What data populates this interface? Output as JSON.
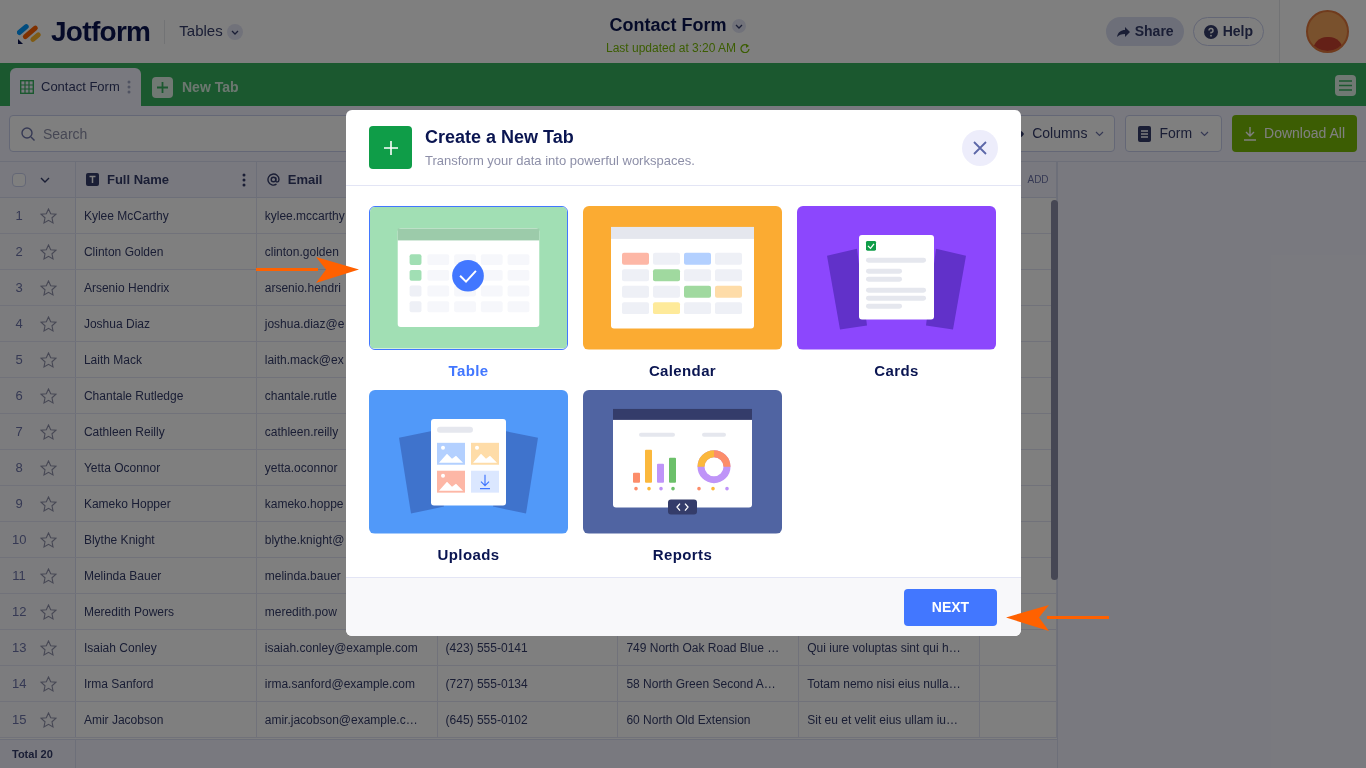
{
  "header": {
    "logo_text": "Jotform",
    "product": "Tables",
    "title": "Contact Form",
    "subtitle": "Last updated at 3:20 AM",
    "buttons": [
      {
        "label": "Share",
        "kind": "share"
      },
      {
        "label": "Help",
        "kind": "help"
      }
    ]
  },
  "tabs": [
    {
      "label": "Contact Form",
      "selected": true
    }
  ],
  "new_tab": {
    "label": "New Tab"
  },
  "toolbar": {
    "search": {
      "placeholder": "Search"
    },
    "buttons": [
      {
        "label": "Columns",
        "kind": "columns"
      },
      {
        "label": "Form",
        "kind": "form"
      },
      {
        "label": "Download All",
        "kind": "download"
      }
    ]
  },
  "table": {
    "select_all": {
      "checked": false
    },
    "columns": [
      {
        "label": "Full Name",
        "kind": "text"
      },
      {
        "label": "Email",
        "kind": "email"
      }
    ],
    "add_column": "ADD",
    "rows": [
      {
        "number": "1",
        "starred": false,
        "cells": [
          "Kylee McCarthy",
          "kylee.mccarthy"
        ]
      },
      {
        "number": "2",
        "starred": false,
        "cells": [
          "Clinton Golden",
          "clinton.golden"
        ]
      },
      {
        "number": "3",
        "starred": false,
        "cells": [
          "Arsenio Hendrix",
          "arsenio.hendri"
        ]
      },
      {
        "number": "4",
        "starred": false,
        "cells": [
          "Joshua Diaz",
          "joshua.diaz@e"
        ]
      },
      {
        "number": "5",
        "starred": false,
        "cells": [
          "Laith Mack",
          "laith.mack@ex"
        ]
      },
      {
        "number": "6",
        "starred": false,
        "cells": [
          "Chantale Rutledge",
          "chantale.rutle"
        ]
      },
      {
        "number": "7",
        "starred": false,
        "cells": [
          "Cathleen Reilly",
          "cathleen.reilly"
        ]
      },
      {
        "number": "8",
        "starred": false,
        "cells": [
          "Yetta Oconnor",
          "yetta.oconnor"
        ]
      },
      {
        "number": "9",
        "starred": false,
        "cells": [
          "Kameko Hopper",
          "kameko.hoppe"
        ]
      },
      {
        "number": "10",
        "starred": false,
        "cells": [
          "Blythe Knight",
          "blythe.knight@"
        ]
      },
      {
        "number": "11",
        "starred": false,
        "cells": [
          "Melinda Bauer",
          "melinda.bauer"
        ]
      },
      {
        "number": "12",
        "starred": false,
        "cells": [
          "Meredith Powers",
          "meredith.pow"
        ]
      },
      {
        "number": "13",
        "starred": false,
        "cells": [
          "Isaiah Conley",
          "isaiah.conley@example.com",
          "(423) 555-0141",
          "749 North Oak Road Blue …",
          "Qui iure voluptas sint qui h…"
        ]
      },
      {
        "number": "14",
        "starred": false,
        "cells": [
          "Irma Sanford",
          "irma.sanford@example.com",
          "(727) 555-0134",
          "58 North Green Second A…",
          "Totam nemo nisi eius nulla…"
        ]
      },
      {
        "number": "15",
        "starred": false,
        "cells": [
          "Amir Jacobson",
          "amir.jacobson@example.c…",
          "(645) 555-0102",
          "60 North Old Extension",
          "Sit eu et velit eius ullam iu…"
        ]
      }
    ]
  },
  "footer": {
    "total": "Total 20"
  },
  "modal": {
    "title": "Create a New Tab",
    "subtitle": "Transform your data into powerful workspaces.",
    "options": [
      {
        "label": "Table",
        "kind": "table",
        "selected": true
      },
      {
        "label": "Calendar",
        "kind": "calendar",
        "selected": false
      },
      {
        "label": "Cards",
        "kind": "cards",
        "selected": false
      },
      {
        "label": "Uploads",
        "kind": "uploads",
        "selected": false
      },
      {
        "label": "Reports",
        "kind": "reports",
        "selected": false
      }
    ],
    "next": "NEXT"
  }
}
